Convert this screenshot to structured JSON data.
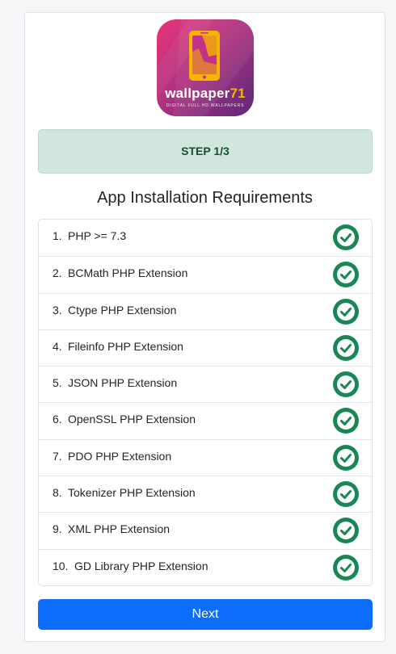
{
  "logo": {
    "word": "wallpaper",
    "word_number": "71",
    "tagline": "DIGITAL FULL HD WALLPAPERS",
    "colors": {
      "bg_top": "#e8357a",
      "bg_bottom": "#5a2a7a",
      "phone": "#f5b400"
    }
  },
  "step": {
    "label": "STEP 1/3"
  },
  "heading": "App Installation Requirements",
  "requirements": [
    {
      "num": "1.",
      "label": "PHP >= 7.3",
      "status": "check-circle-icon"
    },
    {
      "num": "2.",
      "label": "BCMath PHP Extension",
      "status": "check-circle-icon"
    },
    {
      "num": "3.",
      "label": "Ctype PHP Extension",
      "status": "check-circle-icon"
    },
    {
      "num": "4.",
      "label": "Fileinfo PHP Extension",
      "status": "check-circle-icon"
    },
    {
      "num": "5.",
      "label": "JSON PHP Extension",
      "status": "check-circle-icon"
    },
    {
      "num": "6.",
      "label": "OpenSSL PHP Extension",
      "status": "check-circle-icon"
    },
    {
      "num": "7.",
      "label": "PDO PHP Extension",
      "status": "check-circle-icon"
    },
    {
      "num": "8.",
      "label": "Tokenizer PHP Extension",
      "status": "check-circle-icon"
    },
    {
      "num": "9.",
      "label": "XML PHP Extension",
      "status": "check-circle-icon"
    },
    {
      "num": "10.",
      "label": "GD Library PHP Extension",
      "status": "check-circle-icon"
    }
  ],
  "next_button": {
    "label": "Next"
  },
  "colors": {
    "check": "#198754",
    "primary": "#0d6efd",
    "success_bg": "#d1e7dd"
  }
}
